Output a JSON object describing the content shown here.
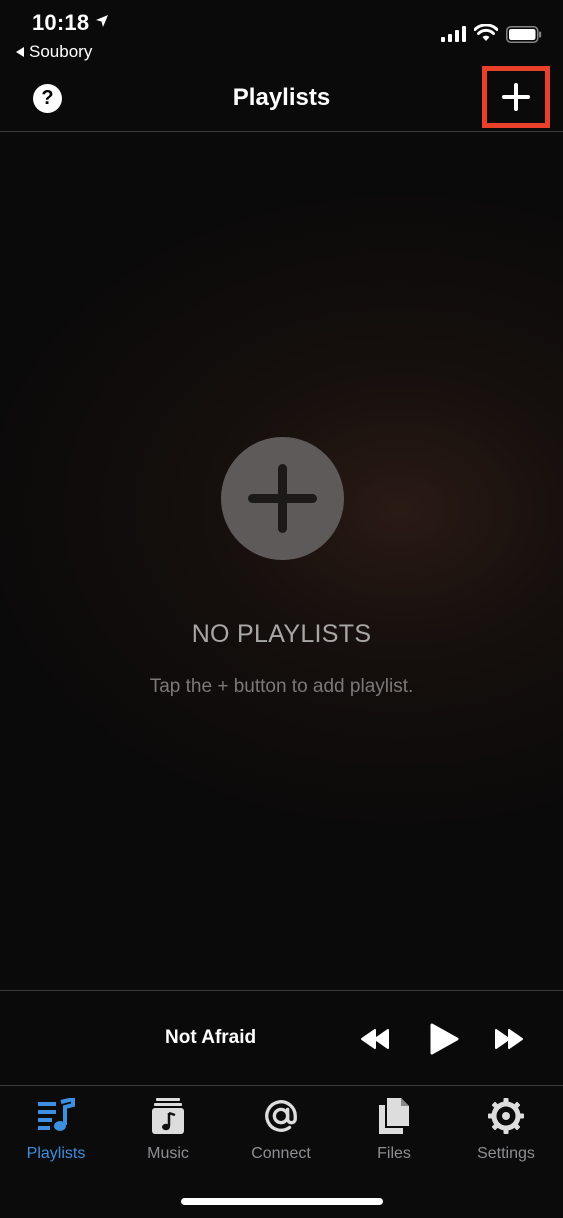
{
  "status_bar": {
    "time": "10:18",
    "back_app": "Soubory"
  },
  "nav": {
    "title": "Playlists",
    "help_label": "?"
  },
  "empty_state": {
    "title": "NO PLAYLISTS",
    "subtitle": "Tap the + button to add playlist."
  },
  "player": {
    "track_title": "Not Afraid"
  },
  "tabs": [
    {
      "label": "Playlists",
      "icon": "playlist-icon",
      "active": true
    },
    {
      "label": "Music",
      "icon": "music-icon",
      "active": false
    },
    {
      "label": "Connect",
      "icon": "at-icon",
      "active": false
    },
    {
      "label": "Files",
      "icon": "files-icon",
      "active": false
    },
    {
      "label": "Settings",
      "icon": "gear-icon",
      "active": false
    }
  ],
  "colors": {
    "accent": "#3d8fe0",
    "highlight_box": "#e8402a",
    "inactive": "#8e8e93"
  }
}
